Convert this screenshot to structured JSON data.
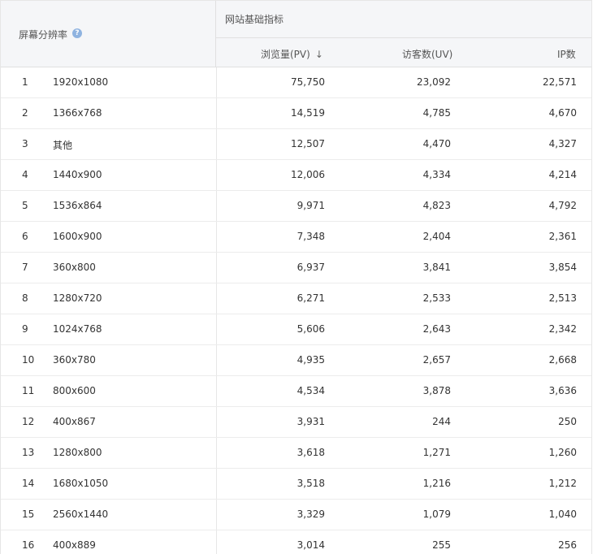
{
  "header": {
    "dimension_label": "屏幕分辨率",
    "help_icon": "?",
    "group_label": "网站基础指标",
    "columns": [
      "浏览量(PV)",
      "访客数(UV)",
      "IP数"
    ],
    "sort_indicator": "↓"
  },
  "rows": [
    {
      "index": "1",
      "resolution": "1920x1080",
      "pv": "75,750",
      "uv": "23,092",
      "ip": "22,571"
    },
    {
      "index": "2",
      "resolution": "1366x768",
      "pv": "14,519",
      "uv": "4,785",
      "ip": "4,670"
    },
    {
      "index": "3",
      "resolution": "其他",
      "pv": "12,507",
      "uv": "4,470",
      "ip": "4,327"
    },
    {
      "index": "4",
      "resolution": "1440x900",
      "pv": "12,006",
      "uv": "4,334",
      "ip": "4,214"
    },
    {
      "index": "5",
      "resolution": "1536x864",
      "pv": "9,971",
      "uv": "4,823",
      "ip": "4,792"
    },
    {
      "index": "6",
      "resolution": "1600x900",
      "pv": "7,348",
      "uv": "2,404",
      "ip": "2,361"
    },
    {
      "index": "7",
      "resolution": "360x800",
      "pv": "6,937",
      "uv": "3,841",
      "ip": "3,854"
    },
    {
      "index": "8",
      "resolution": "1280x720",
      "pv": "6,271",
      "uv": "2,533",
      "ip": "2,513"
    },
    {
      "index": "9",
      "resolution": "1024x768",
      "pv": "5,606",
      "uv": "2,643",
      "ip": "2,342"
    },
    {
      "index": "10",
      "resolution": "360x780",
      "pv": "4,935",
      "uv": "2,657",
      "ip": "2,668"
    },
    {
      "index": "11",
      "resolution": "800x600",
      "pv": "4,534",
      "uv": "3,878",
      "ip": "3,636"
    },
    {
      "index": "12",
      "resolution": "400x867",
      "pv": "3,931",
      "uv": "244",
      "ip": "250"
    },
    {
      "index": "13",
      "resolution": "1280x800",
      "pv": "3,618",
      "uv": "1,271",
      "ip": "1,260"
    },
    {
      "index": "14",
      "resolution": "1680x1050",
      "pv": "3,518",
      "uv": "1,216",
      "ip": "1,212"
    },
    {
      "index": "15",
      "resolution": "2560x1440",
      "pv": "3,329",
      "uv": "1,079",
      "ip": "1,040"
    },
    {
      "index": "16",
      "resolution": "400x889",
      "pv": "3,014",
      "uv": "255",
      "ip": "256"
    }
  ]
}
